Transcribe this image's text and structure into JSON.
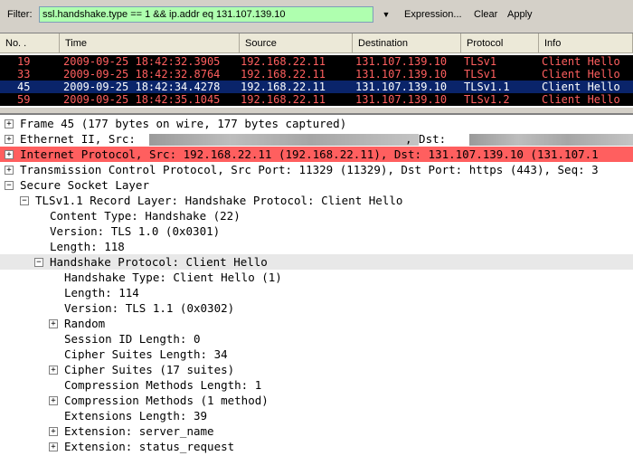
{
  "filter": {
    "label": "Filter:",
    "value": "ssl.handshake.type == 1 && ip.addr eq 131.107.139.10",
    "expression": "Expression...",
    "clear": "Clear",
    "apply": "Apply"
  },
  "packet_list": {
    "columns": [
      "No. .",
      "Time",
      "Source",
      "Destination",
      "Protocol",
      "Info"
    ],
    "rows": [
      {
        "no": "19",
        "time": "2009-09-25 18:42:32.3905",
        "src": "192.168.22.11",
        "dst": "131.107.139.10",
        "proto": "TLSv1",
        "info": "Client Hello"
      },
      {
        "no": "33",
        "time": "2009-09-25 18:42:32.8764",
        "src": "192.168.22.11",
        "dst": "131.107.139.10",
        "proto": "TLSv1",
        "info": "Client Hello"
      },
      {
        "no": "45",
        "time": "2009-09-25 18:42:34.4278",
        "src": "192.168.22.11",
        "dst": "131.107.139.10",
        "proto": "TLSv1.1",
        "info": "Client Hello"
      },
      {
        "no": "59",
        "time": "2009-09-25 18:42:35.1045",
        "src": "192.168.22.11",
        "dst": "131.107.139.10",
        "proto": "TLSv1.2",
        "info": "Client Hello"
      }
    ]
  },
  "details": {
    "frame": "Frame 45 (177 bytes on wire, 177 bytes captured)",
    "ethernet_a": "Ethernet II, Src:",
    "ethernet_b": ", Dst:",
    "ip": "Internet Protocol, Src: 192.168.22.11 (192.168.22.11), Dst: 131.107.139.10 (131.107.1",
    "tcp": "Transmission Control Protocol, Src Port: 11329 (11329), Dst Port: https (443), Seq: 3",
    "ssl": "Secure Socket Layer",
    "record": "TLSv1.1 Record Layer: Handshake Protocol: Client Hello",
    "content_type": "Content Type: Handshake (22)",
    "version": "Version: TLS 1.0 (0x0301)",
    "length": "Length: 118",
    "handshake": "Handshake Protocol: Client Hello",
    "hs_type": "Handshake Type: Client Hello (1)",
    "hs_length": "Length: 114",
    "hs_version": "Version: TLS 1.1 (0x0302)",
    "random": "Random",
    "session_id": "Session ID Length: 0",
    "cipher_len": "Cipher Suites Length: 34",
    "cipher_suites": "Cipher Suites (17 suites)",
    "comp_len": "Compression Methods Length: 1",
    "comp_methods": "Compression Methods (1 method)",
    "ext_len": "Extensions Length: 39",
    "ext_server_name": "Extension: server_name",
    "ext_status": "Extension: status_request"
  },
  "colors": {
    "row_bg": "#000000",
    "row_fg": "#ff5f5f",
    "selected_bg": "#0a246a",
    "filter_bg": "#afffaf",
    "ip_highlight": "#ff5f5f"
  }
}
